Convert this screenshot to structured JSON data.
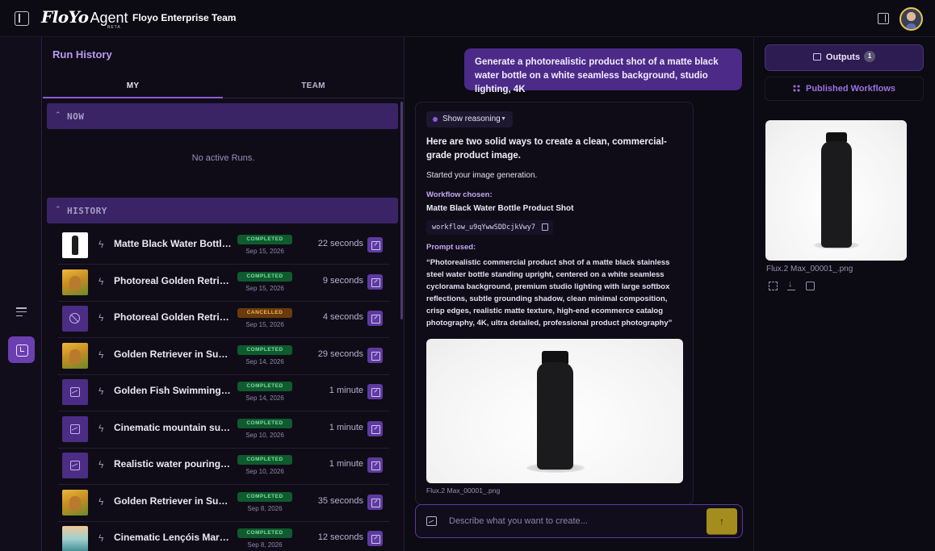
{
  "header": {
    "brand": "FloYo",
    "product": "Agent",
    "beta": "BETA",
    "team": "Floyo Enterprise Team"
  },
  "rail": {
    "items": [
      {
        "icon": "list-icon",
        "active": false
      },
      {
        "icon": "history-icon",
        "active": true
      }
    ]
  },
  "history": {
    "title": "Run History",
    "tabs": [
      "MY",
      "TEAM"
    ],
    "now_label": "NOW",
    "no_runs": "No active Runs.",
    "history_label": "HISTORY",
    "runs": [
      {
        "thumb": "bottle",
        "title": "Matte Black Water Bottle ...",
        "status": "COMPLETED",
        "date": "Sep 15, 2026",
        "duration": "22 seconds"
      },
      {
        "thumb": "dog",
        "title": "Photoreal Golden Retriever...",
        "status": "COMPLETED",
        "date": "Sep 15, 2026",
        "duration": "9 seconds"
      },
      {
        "thumb": "cancel",
        "title": "Photoreal Golden Retrieve...",
        "status": "CANCELLED",
        "date": "Sep 15, 2026",
        "duration": "4 seconds"
      },
      {
        "thumb": "dog",
        "title": "Golden Retriever in Sunflo...",
        "status": "COMPLETED",
        "date": "Sep 14, 2026",
        "duration": "29 seconds"
      },
      {
        "thumb": "image",
        "title": "Golden Fish Swimming - ...",
        "status": "COMPLETED",
        "date": "Sep 14, 2026",
        "duration": "1 minute"
      },
      {
        "thumb": "image",
        "title": "Cinematic mountain sunri...",
        "status": "COMPLETED",
        "date": "Sep 10, 2026",
        "duration": "1 minute"
      },
      {
        "thumb": "image",
        "title": "Realistic water pouring int...",
        "status": "COMPLETED",
        "date": "Sep 10, 2026",
        "duration": "1 minute"
      },
      {
        "thumb": "dog",
        "title": "Golden Retriever in Sunflo...",
        "status": "COMPLETED",
        "date": "Sep 8, 2026",
        "duration": "35 seconds"
      },
      {
        "thumb": "beach",
        "title": "Cinematic Lençóis Maran...",
        "status": "COMPLETED",
        "date": "Sep 8, 2026",
        "duration": "12 seconds"
      }
    ]
  },
  "chat": {
    "user_message": "Generate a photorealistic product shot of a matte black water bottle on a white seamless background, studio lighting, 4K",
    "show_reasoning": "Show reasoning",
    "intro": "Here are two solid ways to create a clean, commercial-grade product image.",
    "started": "Started your image generation.",
    "workflow_label": "Workflow chosen:",
    "workflow_name": "Matte Black Water Bottle Product Shot",
    "workflow_id": "workflow_u9qYwwSDDcjkVwy7",
    "prompt_label": "Prompt used:",
    "prompt": "“Photorealistic commercial product shot of a matte black stainless steel water bottle standing upright, centered on a white seamless cyclorama background, premium studio lighting with large softbox reflections, subtle grounding shadow, clean minimal composition, crisp edges, realistic matte texture, high-end ecommerce catalog photography, 4K, ultra detailed, professional product photography”",
    "image_caption": "Flux.2 Max_00001_.png",
    "composer_placeholder": "Describe what you want to create...",
    "send_icon": "↑"
  },
  "outputs": {
    "outputs_label": "Outputs",
    "outputs_count": "1",
    "published_label": "Published Workflows",
    "caption": "Flux.2 Max_00001_.png"
  },
  "colors": {
    "accent": "#6b3fb0",
    "completed_bg": "#0f5a2e",
    "cancelled_bg": "#6a3a0a",
    "send": "#a48d1e"
  }
}
